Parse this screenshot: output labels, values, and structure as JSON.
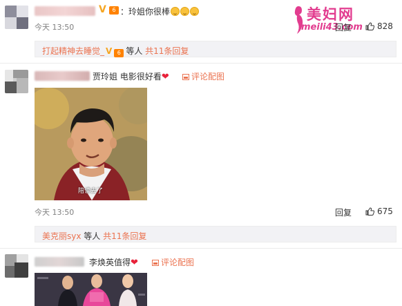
{
  "watermark": {
    "title": "美妇网",
    "url": "meili43.com"
  },
  "comments": [
    {
      "text": "：玲姐你很棒",
      "time": "今天 13:50",
      "reply": "回复",
      "likes": "828",
      "subreply": {
        "user": "打起精神去睡觉_",
        "rest": "等人",
        "count": "共11条回复"
      }
    },
    {
      "text": "贾玲姐 电影很好看",
      "pic_link": "评论配图",
      "photo_caption": "陪读去了",
      "time": "今天 13:50",
      "reply": "回复",
      "likes": "675",
      "subreply": {
        "user": "美克丽syx",
        "rest": "等人",
        "count": "共11条回复"
      }
    },
    {
      "text": "李焕英值得",
      "pic_link": "评论配图"
    }
  ],
  "badge": {
    "v": "V",
    "level": "6"
  },
  "colors": {
    "accent": "#eb7350",
    "heart": "#e8223a",
    "watermark": "#e23c8f"
  }
}
